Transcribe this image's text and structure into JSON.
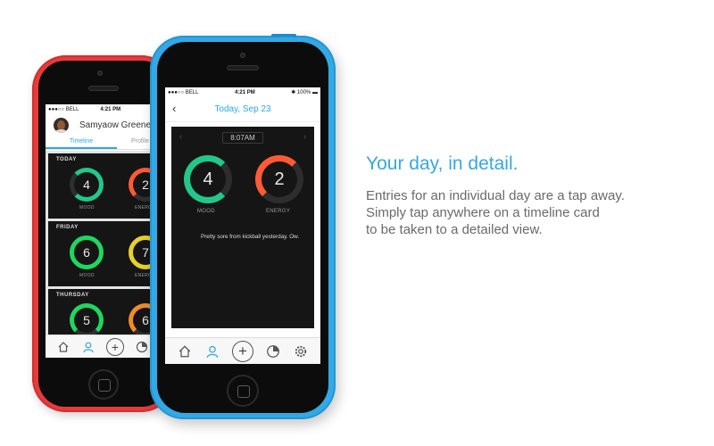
{
  "marketing": {
    "headline": "Your day, in detail.",
    "body_lines": [
      "Entries for an individual day are a tap away.",
      "Simply tap anywhere on a timeline card",
      "to be taken to a detailed view."
    ]
  },
  "timeline_phone": {
    "frame_color": "#e63b3b",
    "status": {
      "carrier": "●●●○○ BELL",
      "time": "4:21 PM"
    },
    "user_name": "Samyaow Greene",
    "tabs": [
      "Timeline",
      "Profile"
    ],
    "cards": [
      {
        "day": "TODAY",
        "mood": "4",
        "energy": "2",
        "mood_label": "MOOD",
        "energy_label": "ENERGY",
        "mood_color": "#22c88a",
        "energy_color": "#ff5a36"
      },
      {
        "day": "FRIDAY",
        "mood": "6",
        "energy": "7",
        "mood_label": "MOOD",
        "energy_label": "ENERGY",
        "mood_color": "#1ed760",
        "energy_color": "#e8d12a"
      },
      {
        "day": "THURSDAY",
        "mood": "5",
        "energy": "6",
        "mood_label": "MOOD",
        "energy_label": "ENERGY",
        "mood_color": "#1ed760",
        "energy_color": "#f08c2a"
      }
    ],
    "tabbar_icons": [
      "home-icon",
      "profile-icon",
      "add-icon",
      "chart-icon"
    ]
  },
  "detail_phone": {
    "frame_color": "#32a9e6",
    "status": {
      "carrier": "●●●○○ BELL",
      "time": "4:21 PM",
      "battery": "100%"
    },
    "nav_title": "Today, Sep 23",
    "time": "8:07AM",
    "mood": {
      "value": "4",
      "label": "MOOD",
      "color": "#22c88a",
      "level": 0.55
    },
    "energy": {
      "value": "2",
      "label": "ENERGY",
      "color": "#ff5a36",
      "level": 0.35
    },
    "note": "Pretty sore from kickball yesterday. Ow.",
    "tabbar_icons": [
      "home-icon",
      "profile-icon",
      "add-icon",
      "chart-icon",
      "settings-icon"
    ]
  }
}
